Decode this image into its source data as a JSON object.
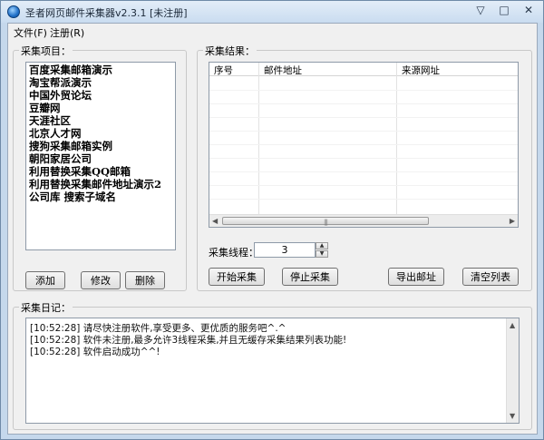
{
  "window": {
    "title": "圣者网页邮件采集器v2.3.1 [未注册]",
    "controls": {
      "minimize": "▽",
      "maximize": "□",
      "close": "✕"
    }
  },
  "menu": {
    "file": "文件(F)",
    "register": "注册(R)"
  },
  "collect_items": {
    "legend": "采集项目：",
    "items": [
      "百度采集邮箱演示",
      "淘宝帮派演示",
      "中国外贸论坛",
      "豆瓣网",
      "天涯社区",
      "北京人才网",
      "搜狗采集邮箱实例",
      "朝阳家居公司",
      "利用替换采集QQ邮箱",
      "利用替换采集邮件地址演示2",
      "公司库 搜索子域名"
    ],
    "buttons": {
      "add": "添加",
      "edit": "修改",
      "delete": "删除"
    }
  },
  "results": {
    "legend": "采集结果：",
    "columns": [
      "序号",
      "邮件地址",
      "来源网址"
    ],
    "threads_label": "采集线程：",
    "threads_value": "3",
    "buttons": {
      "start": "开始采集",
      "stop": "停止采集",
      "export": "导出邮址",
      "clear": "清空列表"
    }
  },
  "log": {
    "legend": "采集日记：",
    "lines": [
      "[10:52:28] 请尽快注册软件,享受更多、更优质的服务吧^.^",
      "[10:52:28] 软件未注册,最多允许3线程采集,并且无缓存采集结果列表功能!",
      "[10:52:28] 软件启动成功^^!"
    ]
  },
  "colors": {
    "accent": "#c5d8ec",
    "face": "#f0f0f0"
  }
}
